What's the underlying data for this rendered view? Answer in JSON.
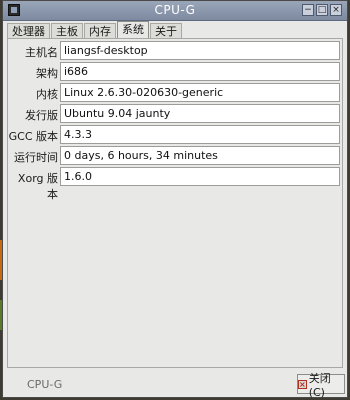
{
  "window": {
    "title": "CPU-G",
    "buttons": {
      "minimize": "−",
      "maximize": "□",
      "close": "×"
    }
  },
  "tabs": [
    {
      "label": "处理器"
    },
    {
      "label": "主板"
    },
    {
      "label": "内存"
    },
    {
      "label": "系统",
      "active": true
    },
    {
      "label": "关于"
    }
  ],
  "system": {
    "rows": [
      {
        "label": "主机名",
        "value": "liangsf-desktop"
      },
      {
        "label": "架构",
        "value": "i686"
      },
      {
        "label": "内核",
        "value": "Linux 2.6.30-020630-generic"
      },
      {
        "label": "发行版",
        "value": "Ubuntu 9.04 jaunty"
      },
      {
        "label": "GCC 版本",
        "value": "4.3.3"
      },
      {
        "label": "运行时间",
        "value": "0 days, 6 hours, 34 minutes"
      },
      {
        "label": "Xorg 版本",
        "value": "1.6.0"
      }
    ]
  },
  "status": {
    "text": "CPU-G"
  },
  "close_button": {
    "label": "关闭(C)",
    "icon": "close-icon"
  },
  "colors": {
    "titlebar": "#8a96ac",
    "window_bg": "#e8e8e6",
    "desktop": "#3e3b33"
  }
}
